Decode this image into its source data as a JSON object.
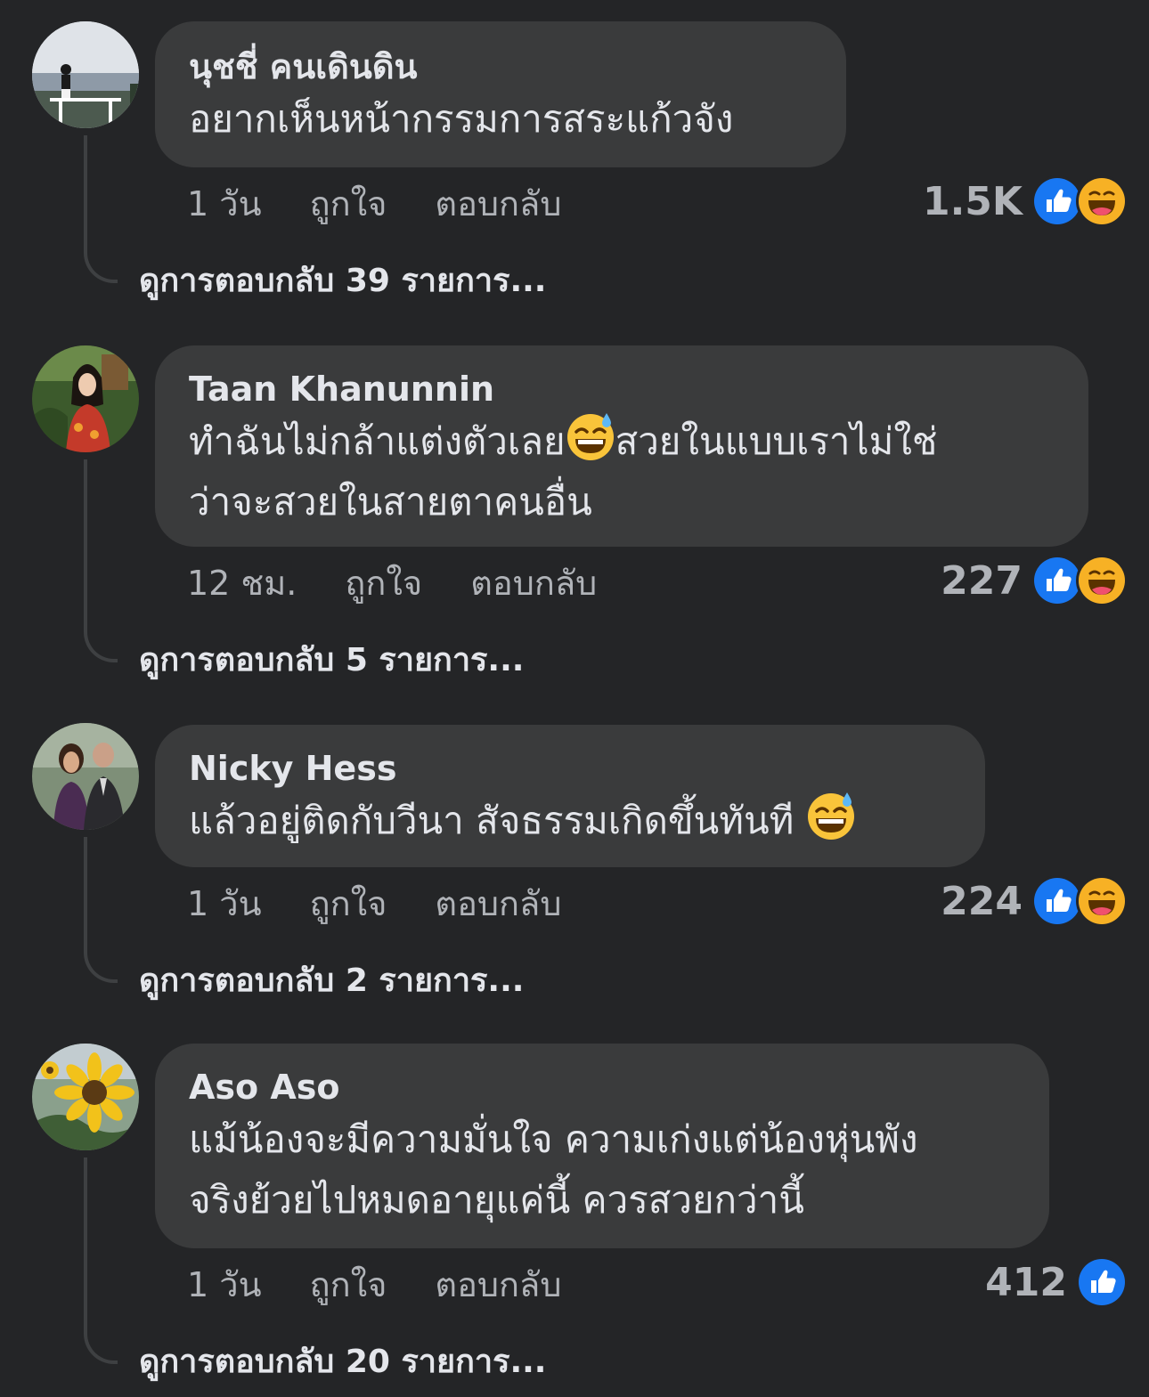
{
  "colors": {
    "background": "#242527",
    "bubble": "#3a3b3c",
    "text_primary": "#e4e6eb",
    "text_secondary": "#b0b3b8",
    "like_blue": "#1877f2",
    "haha_yellow": "#f7b125"
  },
  "actions": {
    "like_label": "ถูกใจ",
    "reply_label": "ตอบกลับ"
  },
  "comments": [
    {
      "author": "นุชชี่ คนเดินดิน",
      "text_lines": [
        "อยากเห็นหน้ากรรมการสระแก้วจัง"
      ],
      "time": "1 วัน",
      "reaction_count": "1.5K",
      "reactions": [
        "like-icon",
        "haha-icon"
      ],
      "view_replies": "ดูการตอบกลับ 39 รายการ..."
    },
    {
      "author": "Taan Khanunnin",
      "text_line1_a": "ทำฉันไม่กล้าแต่งตัวเลย",
      "text_line1_b": "สวยในแบบเราไม่ใช่",
      "text_line2": "ว่าจะสวยในสายตาคนอื่น",
      "inline_emoji": "sweat-smile-emoji",
      "time": "12 ชม.",
      "reaction_count": "227",
      "reactions": [
        "like-icon",
        "haha-icon"
      ],
      "view_replies": "ดูการตอบกลับ 5 รายการ..."
    },
    {
      "author": "Nicky Hess",
      "text_line1": "แล้วอยู่ติดกับวีนา สัจธรรมเกิดขึ้นทันที",
      "inline_emoji": "sweat-smile-emoji",
      "time": "1 วัน",
      "reaction_count": "224",
      "reactions": [
        "like-icon",
        "haha-icon"
      ],
      "view_replies": "ดูการตอบกลับ 2 รายการ..."
    },
    {
      "author": "Aso Aso",
      "text_lines": [
        "แม้น้องจะมีความมั่นใจ ความเก่งแต่น้องหุ่นพัง",
        "จริงย้วยไปหมดอายุแค่นี้ ควรสวยกว่านี้"
      ],
      "time": "1 วัน",
      "reaction_count": "412",
      "reactions": [
        "like-icon"
      ],
      "view_replies": "ดูการตอบกลับ 20 รายการ..."
    }
  ]
}
